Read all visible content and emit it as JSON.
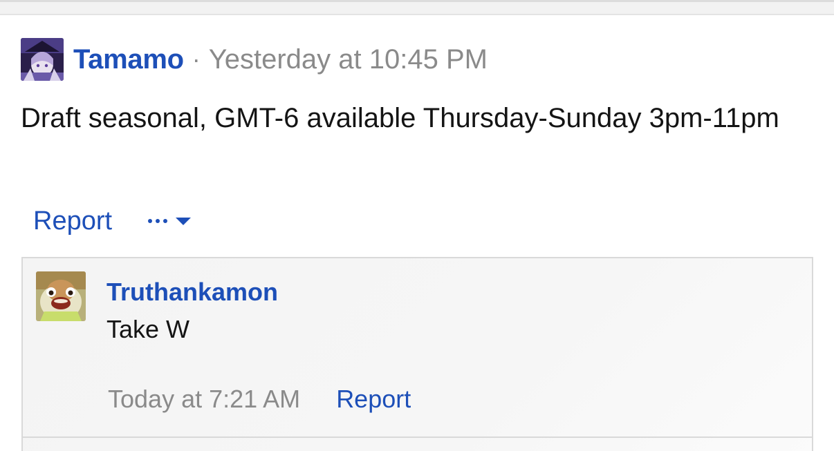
{
  "post": {
    "username": "Tamamo",
    "separator": "·",
    "timestamp": "Yesterday at 10:45 PM",
    "body": "Draft seasonal, GMT-6 available Thursday-Sunday 3pm-11pm",
    "avatar_icon": "anime-character-avatar"
  },
  "actions": {
    "report_label": "Report",
    "more_icon": "ellipsis-icon",
    "caret_icon": "chevron-down-icon"
  },
  "comment": {
    "username": "Truthankamon",
    "text": "Take W",
    "timestamp": "Today at 7:21 AM",
    "report_label": "Report",
    "avatar_icon": "crying-character-avatar"
  },
  "colors": {
    "link": "#1d4fb8",
    "muted": "#8a8a8a",
    "text": "#141414",
    "comment_bg": "#f4f4f4",
    "border": "#d9d9d9"
  }
}
